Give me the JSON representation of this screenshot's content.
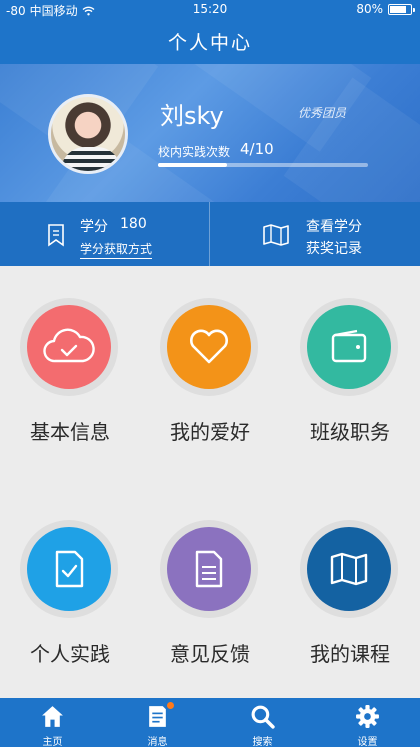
{
  "status_bar": {
    "signal": "-80",
    "carrier": "中国移动",
    "time": "15:20",
    "battery": "80%",
    "battery_level": 0.8
  },
  "header": {
    "title": "个人中心"
  },
  "profile": {
    "name": "刘sky",
    "member_title": "优秀团员",
    "practice_label": "校内实践次数",
    "practice_value": "4/10",
    "practice_progress": 0.33
  },
  "stats": {
    "credit_label": "学分",
    "credit_value": "180",
    "credit_link": "学分获取方式",
    "award_line1": "查看学分",
    "award_line2": "获奖记录"
  },
  "grid": [
    {
      "label": "基本信息",
      "icon": "cloud-check-icon",
      "color": "#f36c6f"
    },
    {
      "label": "我的爱好",
      "icon": "heart-icon",
      "color": "#f39318"
    },
    {
      "label": "班级职务",
      "icon": "wallet-icon",
      "color": "#33b9a0"
    },
    {
      "label": "个人实践",
      "icon": "document-check-icon",
      "color": "#1fa1e6"
    },
    {
      "label": "意见反馈",
      "icon": "document-lines-icon",
      "color": "#8b72bf"
    },
    {
      "label": "我的课程",
      "icon": "map-icon",
      "color": "#1462a2"
    }
  ],
  "tabbar": [
    {
      "label": "主页",
      "icon": "home-icon"
    },
    {
      "label": "消息",
      "icon": "message-icon",
      "has_badge": true
    },
    {
      "label": "搜索",
      "icon": "search-icon"
    },
    {
      "label": "设置",
      "icon": "gear-icon"
    }
  ]
}
